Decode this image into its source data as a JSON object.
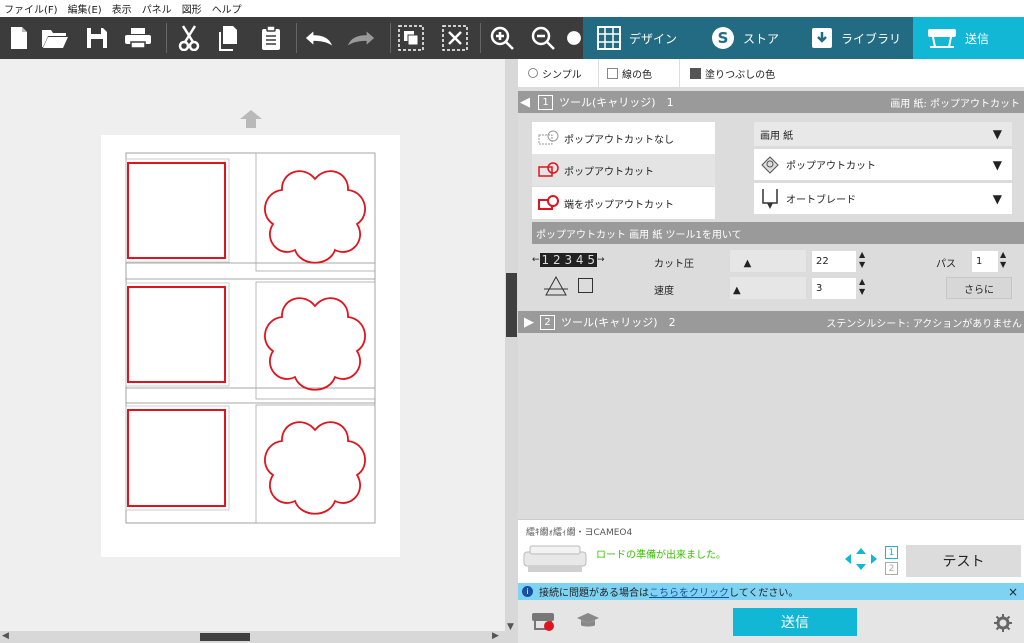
{
  "menu": [
    "ファイル(F)",
    "編集(E)",
    "表示",
    "パネル",
    "図形",
    "ヘルプ"
  ],
  "toolbar_icons": [
    "new-doc-icon",
    "open-folder-icon",
    "save-icon",
    "print-icon",
    "cut-icon",
    "copy-icon",
    "paste-icon",
    "undo-icon",
    "redo-icon",
    "group-icon",
    "ungroup-icon",
    "zoom-in-icon",
    "zoom-out-icon",
    "pan-icon"
  ],
  "tabs": [
    {
      "label": "デザイン",
      "icon": "grid-icon"
    },
    {
      "label": "ストア",
      "icon": "store-s-icon"
    },
    {
      "label": "ライブラリ",
      "icon": "library-download-icon"
    },
    {
      "label": "送信",
      "icon": "cutter-send-icon"
    }
  ],
  "subtabs": {
    "simple": "シンプル",
    "line_color": "線の色",
    "fill_color": "塗りつぶしの色"
  },
  "tool1": {
    "number": "1",
    "label": "ツール(キャリッジ)　1",
    "material": "画用 紙: ポップアウトカット"
  },
  "cut_options": [
    "ポップアウトカットなし",
    "ポップアウトカット",
    "端をポップアウトカット"
  ],
  "dropdowns": {
    "material": "画用 紙",
    "action": "ポップアウトカット",
    "blade": "オートブレード"
  },
  "section_title": "ポップアウトカット 画用 紙 ツール1を用いて",
  "settings": {
    "force_label": "カット圧",
    "force_value": "22",
    "speed_label": "速度",
    "speed_value": "3",
    "pass_label": "パス",
    "pass_value": "1",
    "more_label": "さらに",
    "blade_depth_digits": "1 2 3 4 5"
  },
  "levels": {
    "force": 0.18,
    "speed": 0.04
  },
  "tool2": {
    "number": "2",
    "label": "ツール(キャリッジ)　2",
    "status": "ステンシルシート: アクションがありません"
  },
  "device": {
    "name": "繧ｷ繝ｫ繧ｨ繝・ヨCAMEO4",
    "status": "ロードの準備が出来ました。",
    "test_label": "テスト",
    "tool_slot_1": "1",
    "tool_slot_2": "2"
  },
  "info": {
    "prefix": "接続に問題がある場合は",
    "link": "こちらをクリック",
    "suffix": "してください。",
    "close": "×"
  },
  "send_button": "送信",
  "colors": {
    "accent": "#12b7d6",
    "tab_bg": "#226b83",
    "cut_line": "#e0141e",
    "toolbar": "#3c3c3c",
    "status_green": "#39c200",
    "info_bg": "#7fd3f2"
  }
}
